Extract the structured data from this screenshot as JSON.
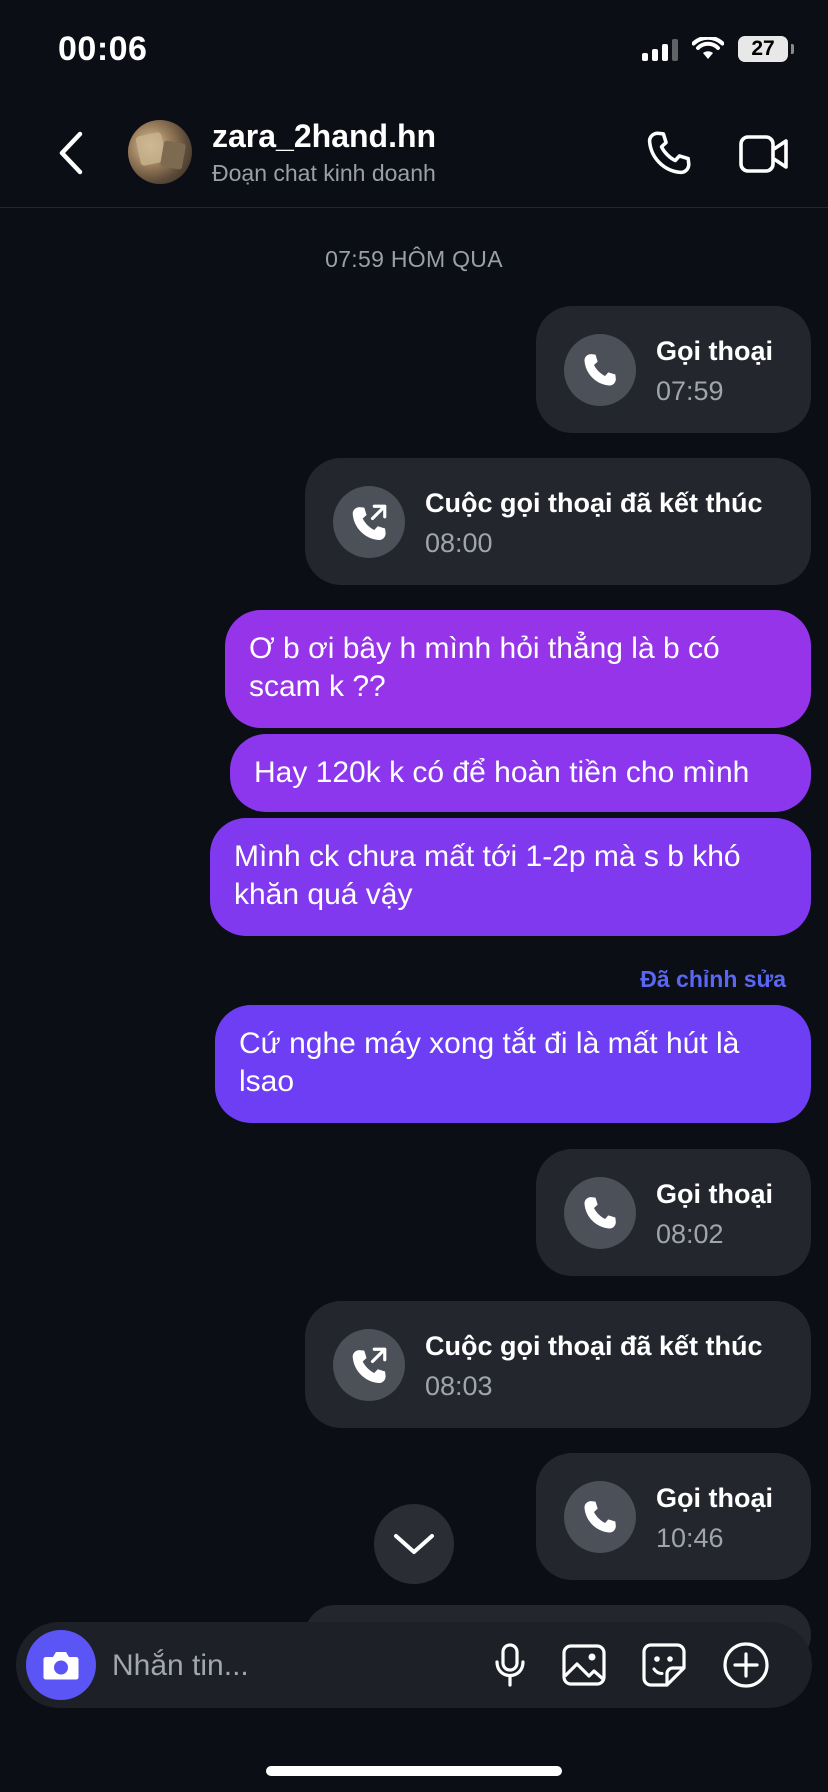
{
  "status_bar": {
    "time": "00:06",
    "battery": "27"
  },
  "header": {
    "contact_name": "zara_2hand.hn",
    "subtitle": "Đoạn chat kinh doanh"
  },
  "chat": {
    "timestamp": "07:59 HÔM QUA",
    "edited_label": "Đã chỉnh sửa",
    "call_events": [
      {
        "title": "Gọi thoại",
        "time": "07:59",
        "icon": "phone-icon"
      },
      {
        "title": "Cuộc gọi thoại đã kết thúc",
        "time": "08:00",
        "icon": "phone-callback-icon"
      },
      {
        "title": "Gọi thoại",
        "time": "08:02",
        "icon": "phone-icon"
      },
      {
        "title": "Cuộc gọi thoại đã kết thúc",
        "time": "08:03",
        "icon": "phone-callback-icon"
      },
      {
        "title": "Gọi thoại",
        "time": "10:46",
        "icon": "phone-icon"
      }
    ],
    "messages": [
      {
        "text": "Ơ b ơi bây h mình hỏi thẳng là b có scam k ??"
      },
      {
        "text": "Hay 120k k có để hoàn tiền cho mình"
      },
      {
        "text": "Mình ck chưa mất tới 1-2p mà s b khó khăn quá vậy"
      },
      {
        "text": "Cứ nghe máy xong tắt đi là mất hút là lsao"
      }
    ]
  },
  "composer": {
    "placeholder": "Nhắn tin..."
  },
  "colors": {
    "background": "#0b0e14",
    "card": "#23262d",
    "bubble_start": "#9b33ea",
    "bubble_end": "#6a3ff5",
    "accent": "#5b55f6",
    "edited": "#5a67f2"
  }
}
